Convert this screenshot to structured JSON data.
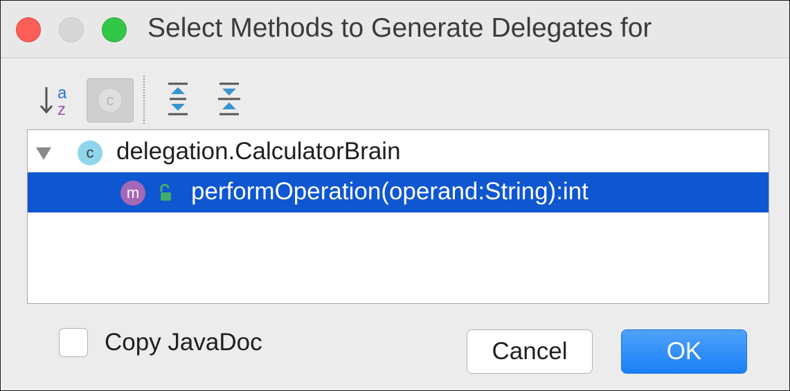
{
  "window": {
    "title": "Select Methods to Generate Delegates for",
    "controls": [
      "close",
      "minimize",
      "zoom"
    ]
  },
  "toolbar": {
    "buttons": [
      {
        "name": "sort-alphabetically",
        "icon": "sort-az-icon",
        "label_top": "a",
        "label_bottom": "z"
      },
      {
        "name": "show-classes",
        "icon": "class-badge-icon",
        "label": "c",
        "state": "pressed-disabled"
      },
      {
        "name": "expand-all",
        "icon": "expand-all-icon"
      },
      {
        "name": "collapse-all",
        "icon": "collapse-all-icon"
      }
    ]
  },
  "tree": {
    "class_node": {
      "badge": "c",
      "label": "delegation.CalculatorBrain",
      "expanded": true
    },
    "method_node": {
      "badge": "m",
      "label": "performOperation(operand:String):int",
      "selected": true
    }
  },
  "options": {
    "copy_javadoc_label": "Copy JavaDoc",
    "copy_javadoc_checked": false
  },
  "buttons": {
    "cancel": "Cancel",
    "ok": "OK"
  },
  "colors": {
    "selection": "#0f56d1",
    "class_badge": "#8fd5ec",
    "method_badge": "#a568b6",
    "ok_button": "#1a7ff6",
    "close": "#fc5f57",
    "zoom": "#33c748"
  }
}
